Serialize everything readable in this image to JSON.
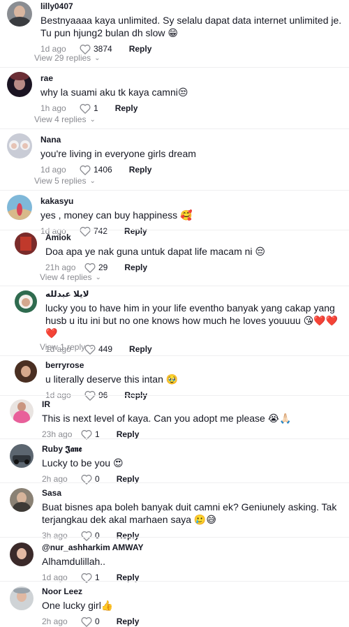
{
  "comments": [
    {
      "username": "lilly0407",
      "text": "Bestnyaaaa kaya unlimited. Sy selalu dapat data internet unlimited je. Tu pun hjung2 bulan dh slow 😁",
      "time": "1d ago",
      "likes": "3874",
      "reply": "Reply",
      "view_replies": "View 29 replies"
    },
    {
      "username": "rae",
      "text": "why la suami aku tk kaya camni😒",
      "time": "1h ago",
      "likes": "1",
      "reply": "Reply",
      "view_replies": "View 4 replies"
    },
    {
      "username": "Nana",
      "text": "you're living in everyone girls dream",
      "time": "1d ago",
      "likes": "1406",
      "reply": "Reply",
      "view_replies": "View 5 replies"
    },
    {
      "username": "kakasyu",
      "text": "yes , money can buy happiness 🥰",
      "time": "1d ago",
      "likes": "742",
      "reply": "Reply"
    },
    {
      "username": "Amiok",
      "text": "Doa apa ye nak guna untuk dapat life macam ni 😔",
      "time": "21h ago",
      "likes": "29",
      "reply": "Reply",
      "view_replies": "View 4 replies"
    },
    {
      "username": "لايلا عبدلله",
      "text": "lucky you to have him in your life eventho banyak yang cakap yang husb u itu ini but no one knows how much he loves youuuu 😘❤️❤️❤️",
      "time": "1d ago",
      "likes": "449",
      "reply": "Reply",
      "view_replies": "View 1 reply"
    },
    {
      "username": "berryrose",
      "text": "u literally deserve this intan 🥹",
      "time": "1d ago",
      "likes": "96",
      "reply": "Reply"
    },
    {
      "username": "IR",
      "text": "This is next level of kaya. Can you adopt me please 😭🙏🏻",
      "time": "23h ago",
      "likes": "1",
      "reply": "Reply"
    },
    {
      "username": "Ruby 𝕵𝖆𝖓𝖊",
      "text": "Lucky to be you 😍",
      "time": "2h ago",
      "likes": "0",
      "reply": "Reply"
    },
    {
      "username": "Sasa",
      "text": "Buat bisnes apa boleh banyak duit camni ek? Geniunely asking. Tak terjangkau dek akal marhaen saya 🥲😅",
      "time": "3h ago",
      "likes": "0",
      "reply": "Reply"
    },
    {
      "username": "@nur_ashharkim AMWAY",
      "text": "Alhamdulillah..",
      "time": "1d ago",
      "likes": "1",
      "reply": "Reply"
    },
    {
      "username": "Noor Leez",
      "text": "One lucky girl👍",
      "time": "2h ago",
      "likes": "0",
      "reply": "Reply"
    }
  ],
  "icons": {
    "like": "heart-outline-icon",
    "expand": "chevron-down-icon"
  },
  "colors": {
    "secondary_text": "#8a8b91",
    "primary_text": "#161823"
  }
}
